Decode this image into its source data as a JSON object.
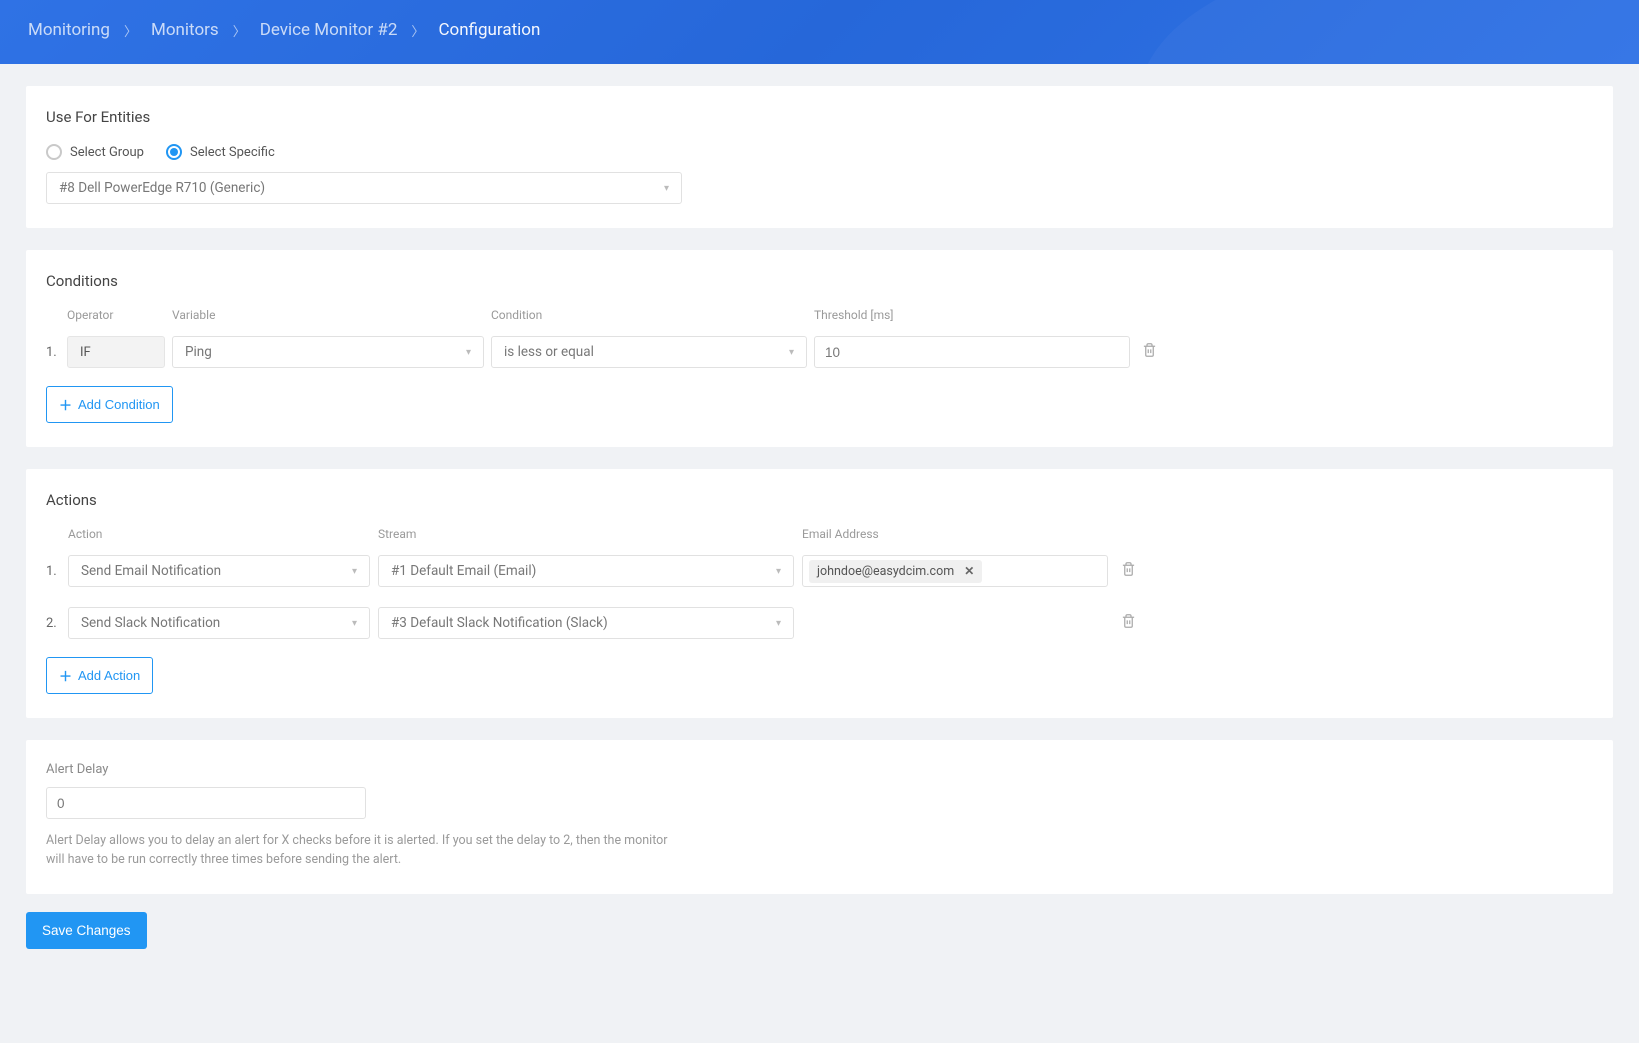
{
  "breadcrumb": [
    "Monitoring",
    "Monitors",
    "Device Monitor #2",
    "Configuration"
  ],
  "entities": {
    "title": "Use For Entities",
    "radios": [
      {
        "label": "Select Group",
        "selected": false
      },
      {
        "label": "Select Specific",
        "selected": true
      }
    ],
    "selected_entity": "#8 Dell PowerEdge R710 (Generic)"
  },
  "conditions": {
    "title": "Conditions",
    "headers": {
      "operator": "Operator",
      "variable": "Variable",
      "condition": "Condition",
      "threshold": "Threshold [ms]"
    },
    "rows": [
      {
        "num": "1.",
        "operator": "IF",
        "variable": "Ping",
        "condition": "is less or equal",
        "threshold": "10"
      }
    ],
    "add_label": "Add Condition"
  },
  "actions": {
    "title": "Actions",
    "headers": {
      "action": "Action",
      "stream": "Stream",
      "email": "Email Address"
    },
    "rows": [
      {
        "num": "1.",
        "action": "Send Email Notification",
        "stream": "#1 Default Email (Email)",
        "email_tag": "johndoe@easydcim.com"
      },
      {
        "num": "2.",
        "action": "Send Slack Notification",
        "stream": "#3 Default Slack Notification (Slack)",
        "email_tag": null
      }
    ],
    "add_label": "Add Action"
  },
  "delay": {
    "title": "Alert Delay",
    "value": "0",
    "help": "Alert Delay allows you to delay an alert for X checks before it is alerted. If you set the delay to 2, then the monitor will have to be run correctly three times before sending the alert."
  },
  "save_label": "Save Changes"
}
